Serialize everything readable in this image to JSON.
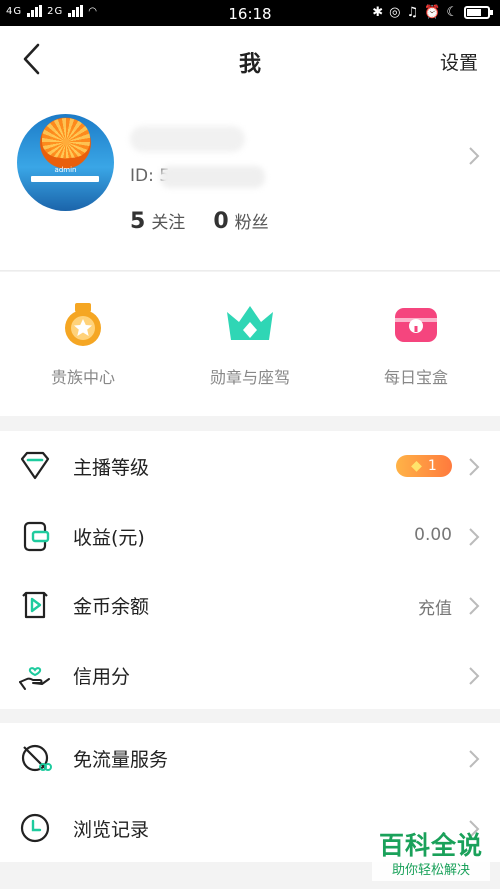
{
  "status_bar": {
    "network_1": "4G",
    "network_2": "2G",
    "time": "16:18"
  },
  "header": {
    "title": "我",
    "settings_label": "设置"
  },
  "profile": {
    "avatar_text": "admin",
    "id_label": "ID: 5",
    "following_count": "5",
    "following_label": "关注",
    "followers_count": "0",
    "followers_label": "粉丝"
  },
  "quick_actions": [
    {
      "label": "贵族中心",
      "icon": "medal-icon",
      "color": "#f5a623"
    },
    {
      "label": "勋章与座驾",
      "icon": "crown-icon",
      "color": "#2fd6b5"
    },
    {
      "label": "每日宝盒",
      "icon": "treasure-box-icon",
      "color": "#f5457e"
    }
  ],
  "menu_group_1": [
    {
      "label": "主播等级",
      "icon": "diamond-icon",
      "badge": "1"
    },
    {
      "label": "收益(元)",
      "icon": "wallet-icon",
      "value": "0.00"
    },
    {
      "label": "金币余额",
      "icon": "coin-play-icon",
      "value": "充值"
    },
    {
      "label": "信用分",
      "icon": "hand-heart-icon"
    }
  ],
  "menu_group_2": [
    {
      "label": "免流量服务",
      "icon": "free-data-icon"
    },
    {
      "label": "浏览记录",
      "icon": "clock-icon"
    }
  ],
  "watermark": {
    "title": "百科全说",
    "subtitle": "助你轻松解决"
  },
  "colors": {
    "accent_green": "#1ecb9e",
    "badge_orange": "#ff8c3a",
    "watermark_green": "#1aa15a"
  }
}
